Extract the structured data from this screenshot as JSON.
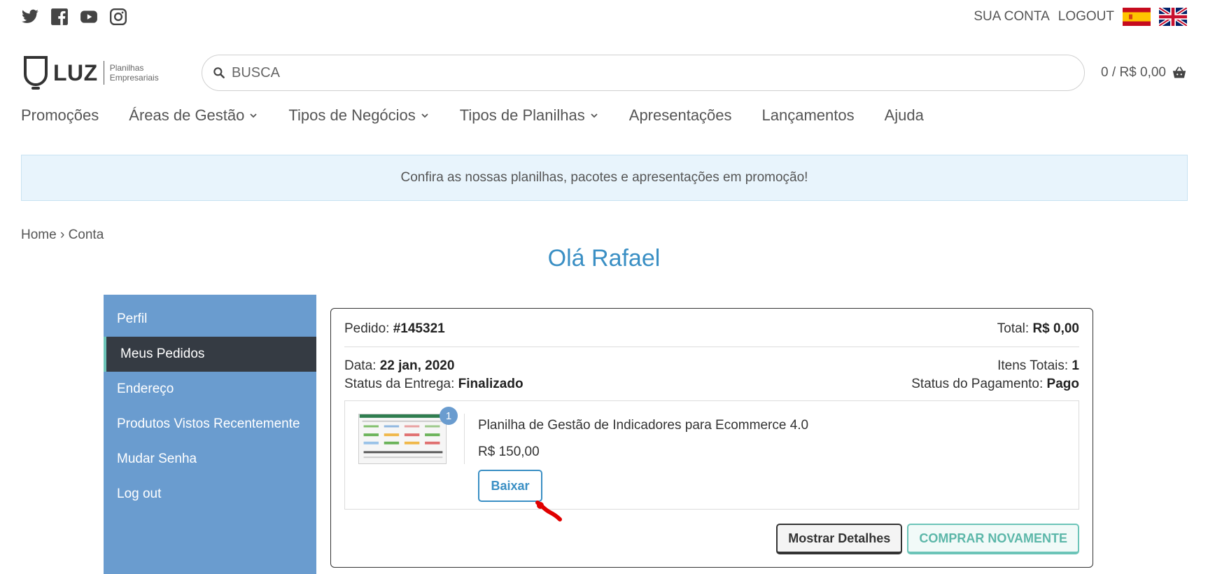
{
  "social": [
    "twitter-icon",
    "facebook-icon",
    "youtube-icon",
    "instagram-icon"
  ],
  "top_links": {
    "account": "SUA CONTA",
    "logout": "LOGOUT"
  },
  "logo": {
    "name": "LUZ",
    "sub1": "Planilhas",
    "sub2": "Empresariais"
  },
  "search": {
    "placeholder": "BUSCA"
  },
  "cart": {
    "label": "0 / R$ 0,00"
  },
  "nav": [
    {
      "label": "Promoções",
      "dropdown": false
    },
    {
      "label": "Áreas de Gestão",
      "dropdown": true
    },
    {
      "label": "Tipos de Negócios",
      "dropdown": true
    },
    {
      "label": "Tipos de Planilhas",
      "dropdown": true
    },
    {
      "label": "Apresentações",
      "dropdown": false
    },
    {
      "label": "Lançamentos",
      "dropdown": false
    },
    {
      "label": "Ajuda",
      "dropdown": false
    }
  ],
  "promo": {
    "text": "Confira as nossas planilhas, pacotes e apresentações em promoção!"
  },
  "breadcrumb": {
    "home": "Home",
    "sep": "›",
    "current": "Conta"
  },
  "greeting": "Olá Rafael",
  "sidebar": {
    "items": [
      "Perfil",
      "Meus Pedidos",
      "Endereço",
      "Produtos Vistos Recentemente",
      "Mudar Senha",
      "Log out"
    ],
    "active_index": 1
  },
  "order": {
    "pedido_label": "Pedido:",
    "pedido_value": "#145321",
    "total_label": "Total:",
    "total_value": "R$ 0,00",
    "data_label": "Data:",
    "data_value": "22 jan, 2020",
    "itens_label": "Itens Totais:",
    "itens_value": "1",
    "entrega_label": "Status da Entrega:",
    "entrega_value": "Finalizado",
    "pagamento_label": "Status do Pagamento:",
    "pagamento_value": "Pago",
    "item": {
      "qty_badge": "1",
      "name": "Planilha de Gestão de Indicadores para Ecommerce 4.0",
      "price": "R$ 150,00",
      "download_label": "Baixar"
    },
    "details_label": "Mostrar Detalhes",
    "buy_again_label": "COMPRAR NOVAMENTE"
  },
  "colors": {
    "accent_blue": "#3a8fc4",
    "sidebar_bg": "#6a9ccf",
    "sidebar_active": "#353b43",
    "teal": "#6cc4b8",
    "promo_bg": "#e8f4fc"
  }
}
